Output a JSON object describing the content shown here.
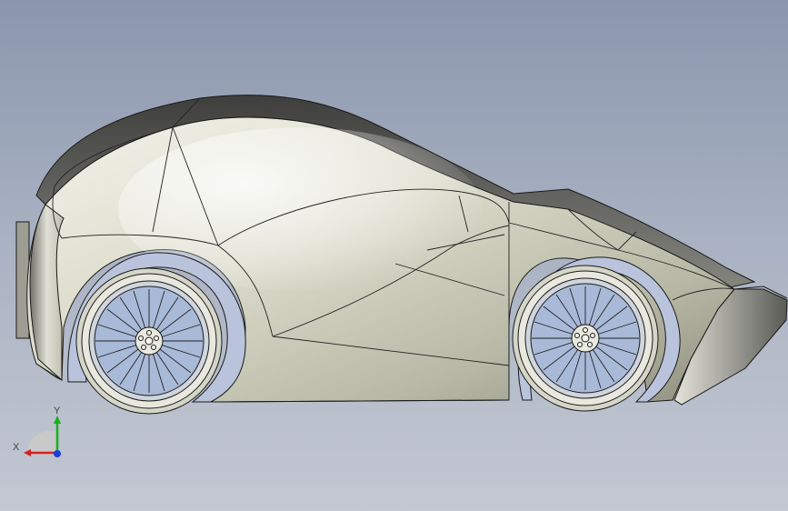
{
  "viewport": {
    "background_top": "#8b96ad",
    "background_bottom": "#c3c8d2",
    "model": {
      "body_color": "#dcdccb",
      "roof_color": "#6e6e6a",
      "edge_color": "#1a1a1a",
      "wheel_rim_color": "#e6e6dc",
      "tire_color": "#9fb0cf"
    }
  },
  "triad": {
    "x_label": "X",
    "y_label": "Y",
    "x_color": "#d62020",
    "y_color": "#18b018",
    "z_color": "#1a3fd6"
  }
}
